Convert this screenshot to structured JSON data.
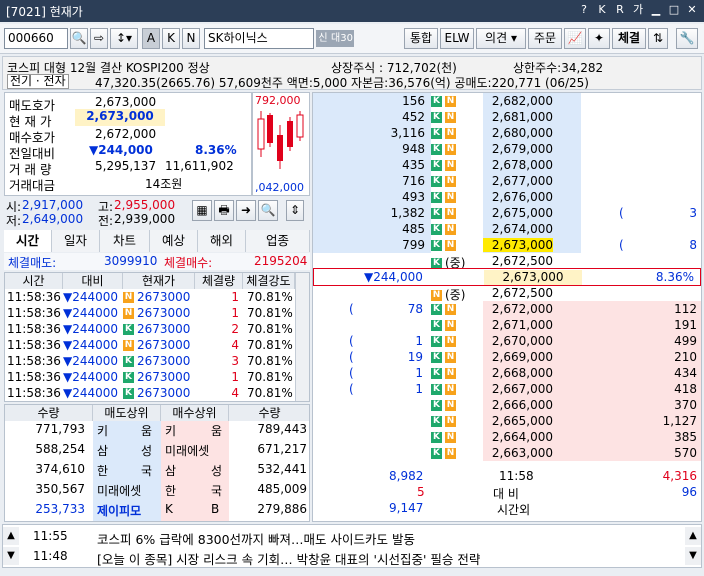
{
  "window": {
    "title": "[7021]  현재가",
    "controls": [
      "?",
      "K",
      "R",
      "가"
    ]
  },
  "toolbar": {
    "code": "000660",
    "name": "SK하이닉스",
    "tag1": "신",
    "tag2": "대30",
    "btn_a": "A",
    "btn_k": "K",
    "btn_n": "N",
    "btn_integrated": "통합",
    "btn_elw": "ELW",
    "btn_opinion": "의견",
    "btn_order": "주문",
    "btn_execution": "체결"
  },
  "info": {
    "row1_left": "코스피 대형 12월 결산 KOSPI200 정상",
    "row1_listed": "상장주식 : 712,702(천)",
    "row1_limit": "상한주수:34,282",
    "row2_left": "전기 · 전자",
    "row2_rest": "47,320.35(2665.76) 57,609천주 액면:5,000 자본금:36,576(억) 공매도:220,771 (06/25)"
  },
  "summary": {
    "ask_label": "매도호가",
    "ask": "2,673,000",
    "cur_label": "현 재 가",
    "cur": "2,673,000",
    "bid_label": "매수호가",
    "bid": "2,672,000",
    "chg_label": "전일대비",
    "chg": "▼244,000",
    "chg_pct": "8.36%",
    "vol_label": "거 래 량",
    "vol": "5,295,137",
    "vol2": "11,611,902",
    "amt_label": "거래대금",
    "amt": "14조원"
  },
  "minichart": {
    "high": "792,000",
    "low": ",042,000"
  },
  "ohlc": {
    "open_label": "시:",
    "open": "2,917,000",
    "high_label": "고:",
    "high": "2,955,000",
    "low_label": "저:",
    "low": "2,649,000",
    "close_label": "전:",
    "close": "2,939,000"
  },
  "tabs": [
    "시간",
    "일자",
    "차트",
    "예상",
    "해외",
    "업종"
  ],
  "exec_summary": {
    "sell_label": "체결매도:",
    "sell": "3099910",
    "buy_label": "체결매수:",
    "buy": "2195204"
  },
  "trades": {
    "headers": [
      "시간",
      "대비",
      "현재가",
      "체결량",
      "체결강도"
    ],
    "rows": [
      [
        "11:58:36",
        "▼244000",
        "N",
        "2673000",
        "1",
        "70.81%"
      ],
      [
        "11:58:36",
        "▼244000",
        "N",
        "2673000",
        "1",
        "70.81%"
      ],
      [
        "11:58:36",
        "▼244000",
        "K",
        "2673000",
        "2",
        "70.81%"
      ],
      [
        "11:58:36",
        "▼244000",
        "N",
        "2673000",
        "4",
        "70.81%"
      ],
      [
        "11:58:36",
        "▼244000",
        "K",
        "2673000",
        "3",
        "70.81%"
      ],
      [
        "11:58:36",
        "▼244000",
        "K",
        "2673000",
        "1",
        "70.81%"
      ],
      [
        "11:58:36",
        "▼244000",
        "K",
        "2673000",
        "4",
        "70.81%"
      ]
    ]
  },
  "brokers": {
    "headers": [
      "수량",
      "매도상위",
      "매수상위",
      "수량"
    ],
    "rows": [
      [
        "771,793",
        "키",
        "움",
        "키",
        "움",
        "789,443"
      ],
      [
        "588,254",
        "삼",
        "성",
        "미래에셋",
        "",
        "671,217"
      ],
      [
        "374,610",
        "한",
        "국",
        "삼",
        "성",
        "532,441"
      ],
      [
        "350,567",
        "미래에셋",
        "",
        "한",
        "국",
        "485,009"
      ],
      [
        "253,733",
        "제이피모",
        "",
        "K",
        "B",
        "279,886"
      ]
    ]
  },
  "asks": [
    [
      "156",
      "2,682,000",
      ""
    ],
    [
      "452",
      "2,681,000",
      ""
    ],
    [
      "3,116",
      "2,680,000",
      ""
    ],
    [
      "948",
      "2,679,000",
      ""
    ],
    [
      "435",
      "2,678,000",
      ""
    ],
    [
      "716",
      "2,677,000",
      ""
    ],
    [
      "493",
      "2,676,000",
      ""
    ],
    [
      "1,382",
      "2,675,000",
      "3"
    ],
    [
      "485",
      "2,674,000",
      ""
    ],
    [
      "799",
      "2,673,000",
      "8"
    ]
  ],
  "mid": {
    "exp_label": "(중)",
    "exp_price": "2,672,500",
    "chg": "▼244,000",
    "cur": "2,673,000",
    "pct": "8.36%",
    "exp2_label": "(중)",
    "exp2_price": "2,672,500"
  },
  "bids": [
    [
      "78",
      "2,672,000",
      "112"
    ],
    [
      "",
      "2,671,000",
      "191"
    ],
    [
      "1",
      "2,670,000",
      "499"
    ],
    [
      "19",
      "2,669,000",
      "210"
    ],
    [
      "1",
      "2,668,000",
      "434"
    ],
    [
      "1",
      "2,667,000",
      "418"
    ],
    [
      "",
      "2,666,000",
      "370"
    ],
    [
      "",
      "2,665,000",
      "1,127"
    ],
    [
      "",
      "2,664,000",
      "385"
    ],
    [
      "",
      "2,663,000",
      "570"
    ]
  ],
  "totals": {
    "ask_total": "8,982",
    "time": "11:58",
    "bid_total": "4,316",
    "ask_diff": "5",
    "diff_label": "대  비",
    "bid_diff": "96",
    "after": "9,147",
    "after_label": "시간외"
  },
  "news": [
    {
      "time": "11:55",
      "text": "코스피 6% 급락에 8300선까지 빠져…매도 사이드카도 발동"
    },
    {
      "time": "11:48",
      "text": "[오늘 이 종목] 시장 리스크 속 기회… 박창윤 대표의 '시선집중' 필승 전략"
    }
  ]
}
